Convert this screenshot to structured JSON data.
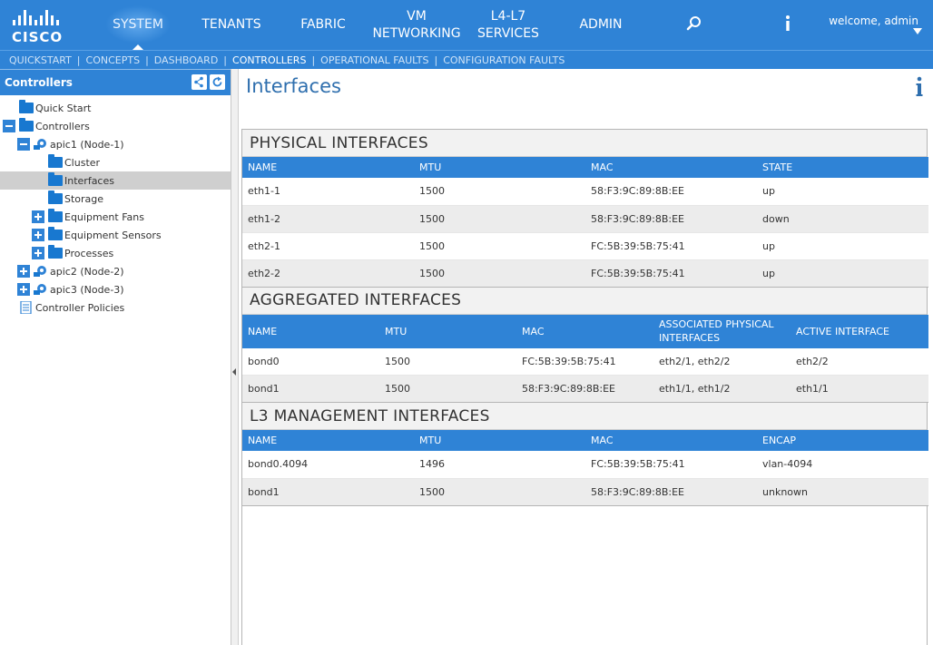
{
  "brand": {
    "logo_text": "CISCO",
    "accent": "#2f83d6"
  },
  "topnav": {
    "tabs": [
      {
        "label": "SYSTEM"
      },
      {
        "label": "TENANTS"
      },
      {
        "label": "FABRIC"
      },
      {
        "label_line1": "VM",
        "label_line2": "NETWORKING"
      },
      {
        "label_line1": "L4-L7",
        "label_line2": "SERVICES"
      },
      {
        "label": "ADMIN"
      }
    ],
    "search_icon": "search-icon",
    "info_icon": "info-icon",
    "welcome": "welcome, admin"
  },
  "subnav": {
    "items": [
      "QUICKSTART",
      "CONCEPTS",
      "DASHBOARD",
      "CONTROLLERS",
      "OPERATIONAL FAULTS",
      "CONFIGURATION FAULTS"
    ],
    "active": "CONTROLLERS"
  },
  "sidebar": {
    "title": "Controllers",
    "tree": [
      {
        "label": "Quick Start"
      },
      {
        "label": "Controllers"
      },
      {
        "label": "apic1 (Node-1)"
      },
      {
        "label": "Cluster"
      },
      {
        "label": "Interfaces"
      },
      {
        "label": "Storage"
      },
      {
        "label": "Equipment Fans"
      },
      {
        "label": "Equipment Sensors"
      },
      {
        "label": "Processes"
      },
      {
        "label": "apic2 (Node-2)"
      },
      {
        "label": "apic3 (Node-3)"
      },
      {
        "label": "Controller Policies"
      }
    ]
  },
  "main": {
    "title": "Interfaces",
    "physical": {
      "title": "PHYSICAL INTERFACES",
      "columns": [
        "NAME",
        "MTU",
        "MAC",
        "STATE"
      ],
      "rows": [
        [
          "eth1-1",
          "1500",
          "58:F3:9C:89:8B:EE",
          "up"
        ],
        [
          "eth1-2",
          "1500",
          "58:F3:9C:89:8B:EE",
          "down"
        ],
        [
          "eth2-1",
          "1500",
          "FC:5B:39:5B:75:41",
          "up"
        ],
        [
          "eth2-2",
          "1500",
          "FC:5B:39:5B:75:41",
          "up"
        ]
      ]
    },
    "aggregated": {
      "title": "AGGREGATED INTERFACES",
      "columns": [
        "NAME",
        "MTU",
        "MAC",
        "ASSOCIATED PHYSICAL INTERFACES",
        "ACTIVE INTERFACE"
      ],
      "rows": [
        [
          "bond0",
          "1500",
          "FC:5B:39:5B:75:41",
          "eth2/1, eth2/2",
          "eth2/2"
        ],
        [
          "bond1",
          "1500",
          "58:F3:9C:89:8B:EE",
          "eth1/1, eth1/2",
          "eth1/1"
        ]
      ]
    },
    "l3": {
      "title": "L3 MANAGEMENT INTERFACES",
      "columns": [
        "NAME",
        "MTU",
        "MAC",
        "ENCAP"
      ],
      "rows": [
        [
          "bond0.4094",
          "1496",
          "FC:5B:39:5B:75:41",
          "vlan-4094"
        ],
        [
          "bond1",
          "1500",
          "58:F3:9C:89:8B:EE",
          "unknown"
        ]
      ]
    }
  }
}
